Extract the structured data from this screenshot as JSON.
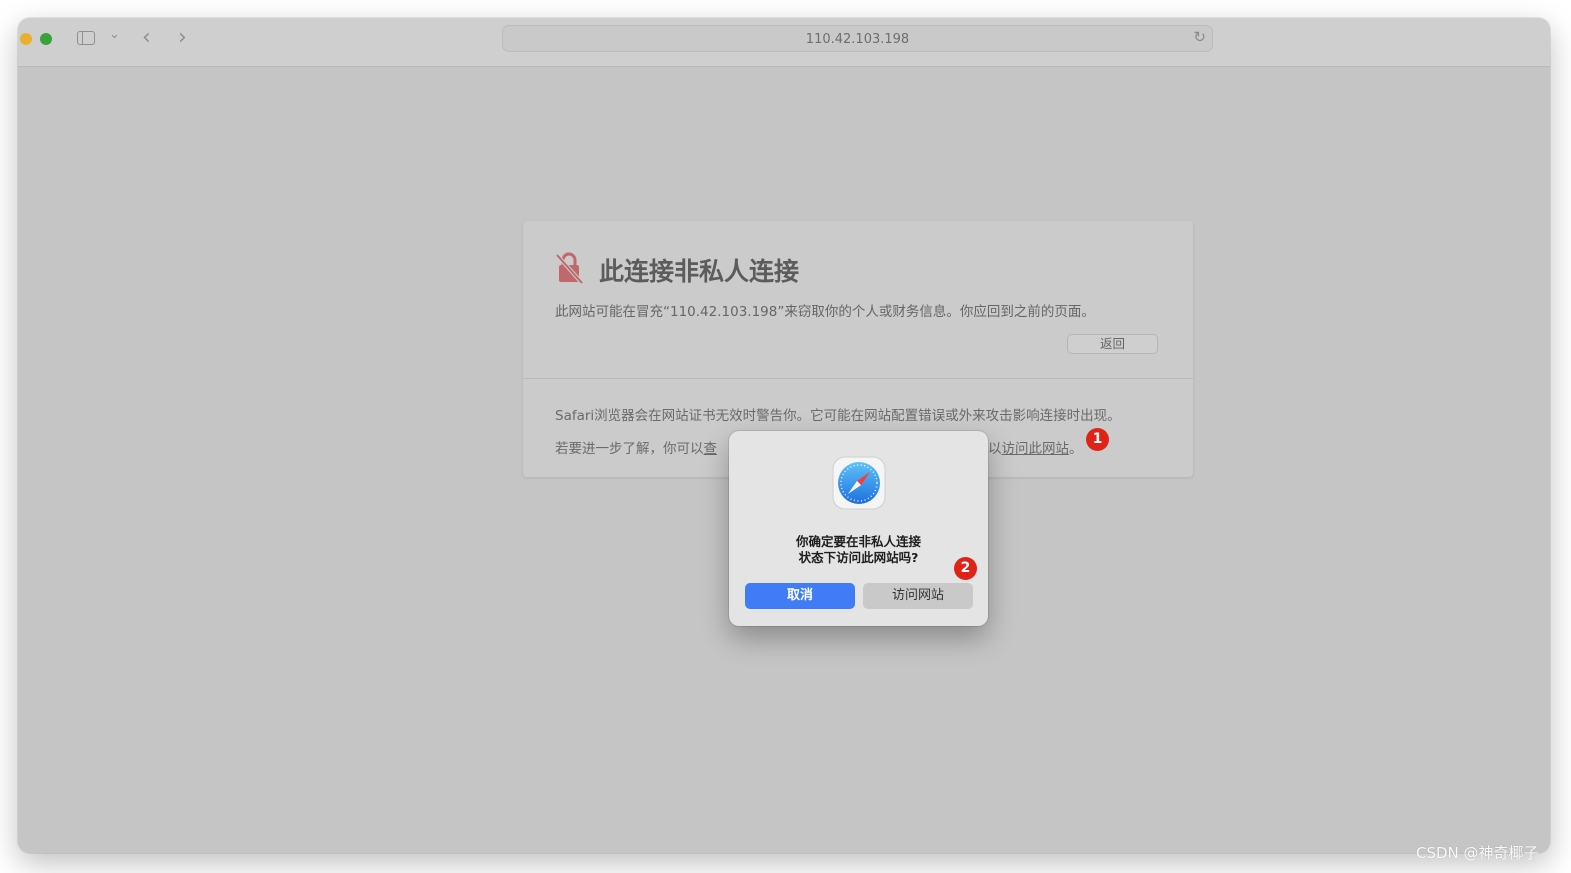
{
  "browser": {
    "address": "110.42.103.198",
    "icons": {
      "sidebar": "sidebar-icon",
      "tab_menu": "chevron-down-icon",
      "back": "chevron-left-icon",
      "forward": "chevron-right-icon",
      "reload": "reload-icon"
    }
  },
  "error_page": {
    "title": "此连接非私人连接",
    "description": "此网站可能在冒充“110.42.103.198”来窃取你的个人或财务信息。你应回到之前的页面。",
    "back_button": "返回",
    "info_line1": "Safari浏览器会在网站证书无效时警告你。它可能在网站配置错误或外来攻击影响连接时出现。",
    "info_line2_prefix": "若要进一步了解，你可以",
    "info_line2_link1": "查",
    "info_line2_suffix_pre": "以",
    "info_line2_link2": "访问此网站",
    "info_line2_end": "。"
  },
  "dialog": {
    "message_line1": "你确定要在非私人连接",
    "message_line2": "状态下访问此网站吗?",
    "cancel_button": "取消",
    "visit_button": "访问网站"
  },
  "annotations": {
    "badge1": "1",
    "badge2": "2"
  },
  "watermark": "CSDN @神奇椰子",
  "colors": {
    "accent": "#3f7cf5",
    "badge": "#e02319",
    "lock": "#c0696b"
  }
}
